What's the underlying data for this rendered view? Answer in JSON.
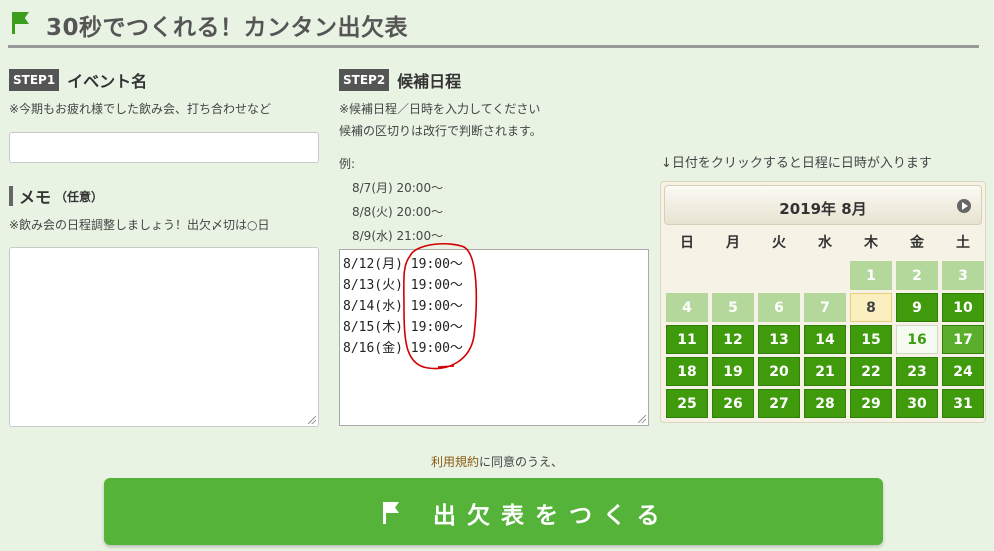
{
  "header": {
    "title": "30秒でつくれる！カンタン出欠表"
  },
  "step1": {
    "badge": "STEP1",
    "title": "イベント名",
    "note": "※今期もお疲れ様でした飲み会、打ち合わせなど",
    "event_name_value": ""
  },
  "memo": {
    "title": "メモ",
    "optional": "（任意）",
    "note": "※飲み会の日程調整しましょう！出欠〆切は○日",
    "value": ""
  },
  "step2": {
    "badge": "STEP2",
    "title": "候補日程",
    "note_line1": "※候補日程／日時を入力してください",
    "note_line2": "候補の区切りは改行で判断されます。",
    "example_label": "例:",
    "examples": [
      "8/7(月) 20:00～",
      "8/8(火) 20:00～",
      "8/9(水) 21:00～"
    ],
    "candidates": [
      "8/12(月) 19:00～",
      "8/13(火) 19:00～",
      "8/14(水) 19:00～",
      "8/15(木) 19:00～",
      "8/16(金) 19:00～"
    ]
  },
  "calendar": {
    "hint": "↓日付をクリックすると日程に日時が入ります",
    "title": "2019年 8月",
    "weekdays": [
      "日",
      "月",
      "火",
      "水",
      "木",
      "金",
      "土"
    ],
    "today": 8,
    "selected": 16,
    "accent_color": "#3f9a0c",
    "past_color": "#b4d89b"
  },
  "footer": {
    "agree_link": "利用規約",
    "agree_rest": "に同意のうえ、",
    "submit_label": "出欠表をつくる"
  }
}
